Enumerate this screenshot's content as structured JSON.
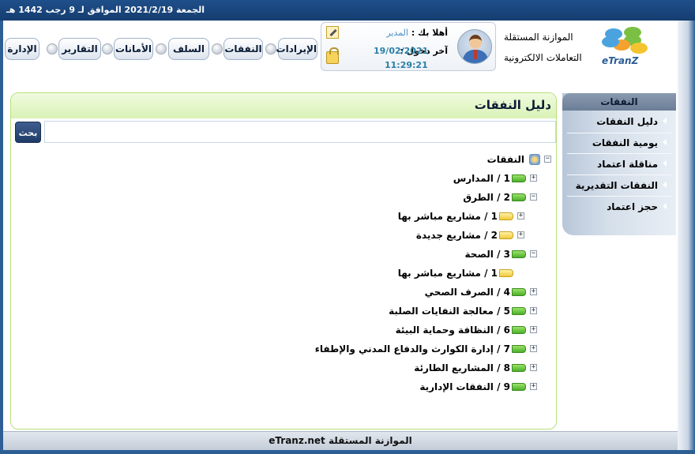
{
  "topbar": {
    "date_text": "الجمعة 2021/2/19 الموافق لـ 9 رجب 1442 هـ"
  },
  "nav": {
    "buttons": [
      "الإيرادات",
      "النفقات",
      "السلف",
      "الأمانات",
      "التقارير",
      "الإدارة"
    ]
  },
  "user": {
    "welcome_label": "أهلا بك :",
    "name": "المدير",
    "last_login_label": "آخر دخول :",
    "last_login_date": "19/02/2021",
    "last_login_time": "11:29:21"
  },
  "app": {
    "title_line1": "الموازنة المستقلة",
    "title_line2": "التعاملات الالكترونية",
    "logo_text": "eTranZ"
  },
  "sidebar": {
    "header": "النفقات",
    "items": [
      "دليل النفقات",
      "يومية النفقات",
      "مناقلة اعتماد",
      "النفقات التقديرية",
      "حجز اعتماد"
    ]
  },
  "panel": {
    "title": "دليل النفقات",
    "search_placeholder": "",
    "search_button": "بحث"
  },
  "tree": [
    {
      "label": "النفقات",
      "level": 0,
      "toggle": "−",
      "icon": "root"
    },
    {
      "label": "1 / المدارس",
      "level": 1,
      "toggle": "+",
      "icon": "green"
    },
    {
      "label": "2 / الطرق",
      "level": 1,
      "toggle": "−",
      "icon": "green"
    },
    {
      "label": "1 / مشاريع مباشر بها",
      "level": 2,
      "toggle": "+",
      "icon": "yellow"
    },
    {
      "label": "2 / مشاريع جديدة",
      "level": 2,
      "toggle": "+",
      "icon": "yellow"
    },
    {
      "label": "3 / الصحة",
      "level": 1,
      "toggle": "−",
      "icon": "green"
    },
    {
      "label": "1 / مشاريع مباشر بها",
      "level": 2,
      "toggle": "",
      "icon": "yellow"
    },
    {
      "label": "4 / الصرف الصحي",
      "level": 1,
      "toggle": "+",
      "icon": "green"
    },
    {
      "label": "5 / معالجة النفايات الصلبة",
      "level": 1,
      "toggle": "+",
      "icon": "green"
    },
    {
      "label": "6 / النظافة وحماية البيئة",
      "level": 1,
      "toggle": "+",
      "icon": "green"
    },
    {
      "label": "7 / إدارة الكوارث والدفاع المدني والإطفاء",
      "level": 1,
      "toggle": "+",
      "icon": "green"
    },
    {
      "label": "8 / المشاريع الطارئة",
      "level": 1,
      "toggle": "+",
      "icon": "green"
    },
    {
      "label": "9 / النفقات الإدارية",
      "level": 1,
      "toggle": "+",
      "icon": "green"
    }
  ],
  "footer": {
    "text": "الموازنة المستقلة eTranz.net"
  }
}
